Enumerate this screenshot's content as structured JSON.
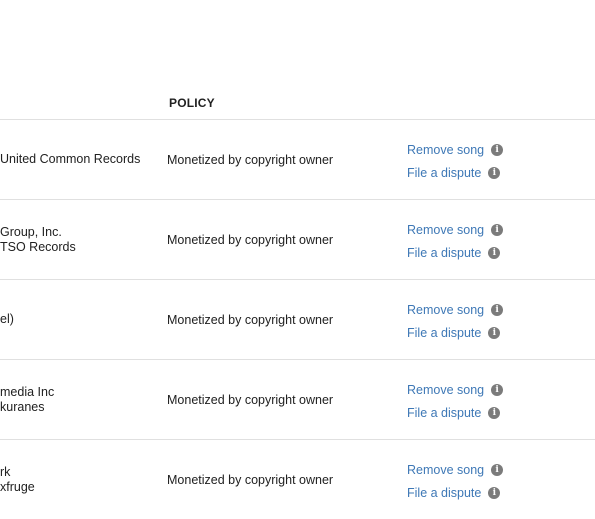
{
  "table": {
    "header": {
      "policy": "POLICY"
    },
    "rows": [
      {
        "claimant_lines": [
          "United Common Records"
        ],
        "policy": "Monetized by copyright owner",
        "actions": [
          "Remove song",
          "File a dispute"
        ]
      },
      {
        "claimant_lines": [
          "Group, Inc.",
          "TSO Records"
        ],
        "policy": "Monetized by copyright owner",
        "actions": [
          "Remove song",
          "File a dispute"
        ]
      },
      {
        "claimant_lines": [
          "el)"
        ],
        "policy": "Monetized by copyright owner",
        "actions": [
          "Remove song",
          "File a dispute"
        ]
      },
      {
        "claimant_lines": [
          "media Inc",
          "kuranes"
        ],
        "policy": "Monetized by copyright owner",
        "actions": [
          "Remove song",
          "File a dispute"
        ]
      },
      {
        "claimant_lines": [
          "rk",
          "xfruge"
        ],
        "policy": "Monetized by copyright owner",
        "actions": [
          "Remove song",
          "File a dispute"
        ]
      }
    ]
  },
  "icons": {
    "info": "info-icon"
  },
  "colors": {
    "link": "#3e78b6",
    "divider": "#e0e0e0",
    "info_icon": "#7b7b7b"
  }
}
